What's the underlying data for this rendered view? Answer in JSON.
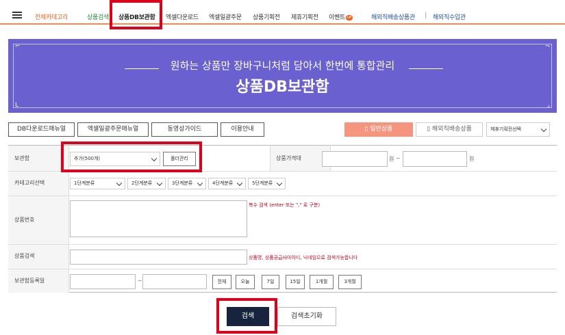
{
  "nav": {
    "menu": "메뉴",
    "all_category": "전체카테고리",
    "items": [
      "상품검색",
      "상품DB보관함",
      "엑셀다운로드",
      "엑셀일괄주문",
      "상품기획전",
      "제휴기획전",
      "이벤트",
      "해외직배송상품관",
      "해외직수입관"
    ],
    "event_badge": "UP",
    "colors": {
      "orange": "#e8641e",
      "green": "#2b8a3e",
      "blue": "#1f4e9c"
    }
  },
  "banner": {
    "line1": "원하는 상품만 장바구니처럼 담아서 한번에 통합관리",
    "line2": "상품DB보관함",
    "color": "#6b60cf"
  },
  "actions": {
    "buttons": [
      "DB다운로드매뉴얼",
      "엑셀일괄주문매뉴얼",
      "동영상가이드",
      "이용안내"
    ],
    "tab_general": "일반상품",
    "tab_overseas": "해외직배송상품",
    "plan_select": "제휴기획전선택"
  },
  "form": {
    "storage_label": "보관함",
    "storage_value": "추가(500개)",
    "folder_btn": "폴더관리",
    "price_label": "상품가격대",
    "won": "원",
    "tilde": "~",
    "category_label": "카테고리선택",
    "categories": [
      "1단계분류",
      "2단계분류",
      "3단계분류",
      "4단계분류",
      "5단계분류"
    ],
    "product_no_label": "상품번호",
    "product_no_note": "복수 검색 (enter 또는 \",\" 로 구분)",
    "search_label": "상품검색",
    "search_note": "상품명, 상품공급사아이디, 닉네임으로 검색가능합니다",
    "date_label": "보관함등록일",
    "date_buttons": [
      "전체",
      "오늘",
      "7일",
      "15일",
      "1개월",
      "3개월"
    ]
  },
  "bottom": {
    "search": "검색",
    "reset": "검색초기화"
  }
}
